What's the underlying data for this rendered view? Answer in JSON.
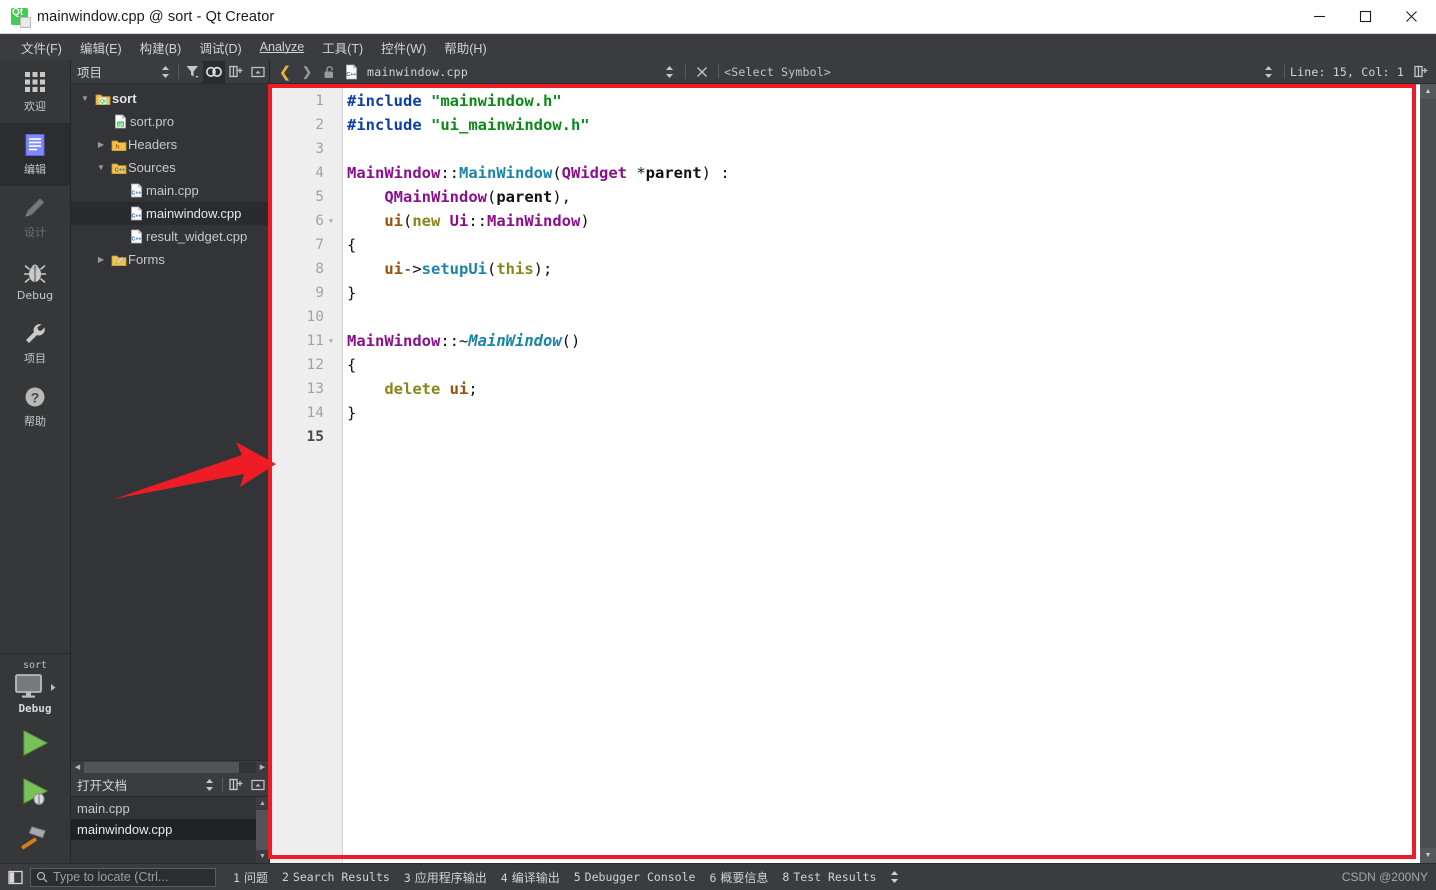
{
  "window": {
    "title": "mainwindow.cpp @ sort - Qt Creator",
    "app_icon": "qt-logo-icon",
    "minimize_label": "—",
    "maximize_label": "□",
    "close_label": "✕"
  },
  "menubar": {
    "items": [
      {
        "text": "文件(F)",
        "mnemonic": "F"
      },
      {
        "text": "编辑(E)",
        "mnemonic": "E"
      },
      {
        "text": "构建(B)",
        "mnemonic": "B"
      },
      {
        "text": "调试(D)",
        "mnemonic": "D"
      },
      {
        "text": "Analyze",
        "mnemonic": "A"
      },
      {
        "text": "工具(T)",
        "mnemonic": "T"
      },
      {
        "text": "控件(W)",
        "mnemonic": "W"
      },
      {
        "text": "帮助(H)",
        "mnemonic": "H"
      }
    ]
  },
  "modebar": {
    "items": [
      {
        "label": "欢迎",
        "icon": "grid-icon",
        "state": "normal"
      },
      {
        "label": "编辑",
        "icon": "document-lines-icon",
        "state": "active"
      },
      {
        "label": "设计",
        "icon": "pencil-icon",
        "state": "disabled"
      },
      {
        "label": "Debug",
        "icon": "bug-icon",
        "state": "normal"
      },
      {
        "label": "项目",
        "icon": "wrench-icon",
        "state": "normal"
      },
      {
        "label": "帮助",
        "icon": "question-mark-icon",
        "state": "normal"
      }
    ],
    "kit_selector": {
      "project": "sort",
      "build_config": "Debug",
      "icon": "monitor-icon",
      "expand_icon": "chevron-right-icon"
    },
    "actions": [
      {
        "name": "run-button",
        "icon": "green-play-icon"
      },
      {
        "name": "debug-button",
        "icon": "green-play-bug-icon"
      },
      {
        "name": "build-button",
        "icon": "hammer-icon"
      }
    ]
  },
  "project_panel": {
    "title": "项目",
    "toolbar": [
      {
        "name": "sync-selector",
        "icon": "up-down-arrows-icon",
        "active": false
      },
      {
        "name": "filter-button",
        "icon": "funnel-icon",
        "active": false
      },
      {
        "name": "link-with-editor",
        "icon": "link-icon",
        "active": true
      },
      {
        "name": "add-split",
        "icon": "split-plus-icon",
        "active": false
      },
      {
        "name": "collapse-panel",
        "icon": "minimize-panel-icon",
        "active": false
      }
    ],
    "tree": [
      {
        "label": "sort",
        "icon": "qt-project-folder-icon",
        "indent": 0,
        "twisty": "down",
        "selected": false,
        "bold": true
      },
      {
        "label": "sort.pro",
        "icon": "qt-pro-file-icon",
        "indent": 1,
        "twisty": "none",
        "selected": false,
        "bold": false
      },
      {
        "label": "Headers",
        "icon": "folder-h-icon",
        "indent": 1,
        "twisty": "right",
        "selected": false,
        "bold": false
      },
      {
        "label": "Sources",
        "icon": "folder-cpp-icon",
        "indent": 1,
        "twisty": "down",
        "selected": false,
        "bold": false
      },
      {
        "label": "main.cpp",
        "icon": "cpp-file-icon",
        "indent": 2,
        "twisty": "none",
        "selected": false,
        "bold": false
      },
      {
        "label": "mainwindow.cpp",
        "icon": "cpp-file-icon",
        "indent": 2,
        "twisty": "none",
        "selected": true,
        "bold": false
      },
      {
        "label": "result_widget.cpp",
        "icon": "cpp-file-icon",
        "indent": 2,
        "twisty": "none",
        "selected": false,
        "bold": false
      },
      {
        "label": "Forms",
        "icon": "folder-forms-icon",
        "indent": 1,
        "twisty": "right",
        "selected": false,
        "bold": false
      }
    ]
  },
  "open_documents": {
    "title": "打开文档",
    "toolbar": [
      {
        "name": "sync-selector",
        "icon": "up-down-arrows-icon"
      },
      {
        "name": "add-split",
        "icon": "split-plus-icon"
      },
      {
        "name": "collapse-panel",
        "icon": "minimize-panel-icon"
      }
    ],
    "items": [
      {
        "label": "main.cpp",
        "selected": false
      },
      {
        "label": "mainwindow.cpp",
        "selected": true
      }
    ]
  },
  "editor_toolbar": {
    "back_icon": "chevron-left-icon",
    "forward_icon": "chevron-right-icon",
    "lock_icon": "unlocked-padlock-icon",
    "file_icon": "cpp-file-icon",
    "filename": "mainwindow.cpp",
    "dropdown_icon": "up-down-arrows-icon",
    "close_icon": "close-x-icon",
    "symbol_selector": "<Select Symbol>",
    "position": "Line: 15, Col: 1",
    "split_icon": "split-plus-icon"
  },
  "editor": {
    "lines": [
      {
        "n": "1",
        "fold": "",
        "tokens": [
          {
            "t": "#include ",
            "c": "t-pre"
          },
          {
            "t": "\"mainwindow.h\"",
            "c": "t-str"
          }
        ]
      },
      {
        "n": "2",
        "fold": "",
        "tokens": [
          {
            "t": "#include ",
            "c": "t-pre"
          },
          {
            "t": "\"ui_mainwindow.h\"",
            "c": "t-str"
          }
        ]
      },
      {
        "n": "3",
        "fold": "",
        "tokens": []
      },
      {
        "n": "4",
        "fold": "",
        "tokens": [
          {
            "t": "MainWindow",
            "c": "t-cls"
          },
          {
            "t": "::",
            "c": "t-pun"
          },
          {
            "t": "MainWindow",
            "c": "t-fn"
          },
          {
            "t": "(",
            "c": "t-pun"
          },
          {
            "t": "QWidget",
            "c": "t-cls"
          },
          {
            "t": " *",
            "c": "t-pun"
          },
          {
            "t": "parent",
            "c": "t-var"
          },
          {
            "t": ") :",
            "c": "t-pun"
          }
        ]
      },
      {
        "n": "5",
        "fold": "",
        "tokens": [
          {
            "t": "    ",
            "c": "t-pun"
          },
          {
            "t": "QMainWindow",
            "c": "t-cls"
          },
          {
            "t": "(",
            "c": "t-pun"
          },
          {
            "t": "parent",
            "c": "t-var"
          },
          {
            "t": "),",
            "c": "t-pun"
          }
        ]
      },
      {
        "n": "6",
        "fold": "fold",
        "tokens": [
          {
            "t": "    ",
            "c": "t-pun"
          },
          {
            "t": "ui",
            "c": "t-mem"
          },
          {
            "t": "(",
            "c": "t-pun"
          },
          {
            "t": "new ",
            "c": "t-kw"
          },
          {
            "t": "Ui",
            "c": "t-cls"
          },
          {
            "t": "::",
            "c": "t-pun"
          },
          {
            "t": "MainWindow",
            "c": "t-cls"
          },
          {
            "t": ")",
            "c": "t-pun"
          }
        ]
      },
      {
        "n": "7",
        "fold": "",
        "tokens": [
          {
            "t": "{",
            "c": "t-pun"
          }
        ]
      },
      {
        "n": "8",
        "fold": "",
        "tokens": [
          {
            "t": "    ",
            "c": "t-pun"
          },
          {
            "t": "ui",
            "c": "t-mem"
          },
          {
            "t": "->",
            "c": "t-pun"
          },
          {
            "t": "setupUi",
            "c": "t-fn"
          },
          {
            "t": "(",
            "c": "t-pun"
          },
          {
            "t": "this",
            "c": "t-kw"
          },
          {
            "t": ");",
            "c": "t-pun"
          }
        ]
      },
      {
        "n": "9",
        "fold": "",
        "tokens": [
          {
            "t": "}",
            "c": "t-pun"
          }
        ]
      },
      {
        "n": "10",
        "fold": "",
        "tokens": []
      },
      {
        "n": "11",
        "fold": "fold",
        "tokens": [
          {
            "t": "MainWindow",
            "c": "t-cls"
          },
          {
            "t": "::~",
            "c": "t-pun"
          },
          {
            "t": "MainWindow",
            "c": "t-fni"
          },
          {
            "t": "()",
            "c": "t-pun"
          }
        ]
      },
      {
        "n": "12",
        "fold": "",
        "tokens": [
          {
            "t": "{",
            "c": "t-pun"
          }
        ]
      },
      {
        "n": "13",
        "fold": "",
        "tokens": [
          {
            "t": "    ",
            "c": "t-pun"
          },
          {
            "t": "delete ",
            "c": "t-kw"
          },
          {
            "t": "ui",
            "c": "t-mem"
          },
          {
            "t": ";",
            "c": "t-pun"
          }
        ]
      },
      {
        "n": "14",
        "fold": "",
        "tokens": [
          {
            "t": "}",
            "c": "t-pun"
          }
        ]
      },
      {
        "n": "15",
        "fold": "",
        "current": true,
        "tokens": []
      }
    ]
  },
  "annotation": {
    "rect_color": "#ee1c25",
    "arrow_color": "#ee1c25",
    "arrow_direction": "right"
  },
  "statusbar": {
    "sidebar_toggle_icon": "sidebar-toggle-icon",
    "search_icon": "search-icon",
    "search_placeholder": "Type to locate (Ctrl...",
    "search_value": "",
    "panes": [
      {
        "num": "1",
        "label": "问题",
        "cjk": true
      },
      {
        "num": "2",
        "label": "Search Results",
        "cjk": false
      },
      {
        "num": "3",
        "label": "应用程序输出",
        "cjk": true
      },
      {
        "num": "4",
        "label": "编译输出",
        "cjk": true
      },
      {
        "num": "5",
        "label": "Debugger Console",
        "cjk": false
      },
      {
        "num": "6",
        "label": "概要信息",
        "cjk": true
      },
      {
        "num": "8",
        "label": "Test Results",
        "cjk": false
      }
    ],
    "pane_selector_icon": "up-down-arrows-icon",
    "watermark": "CSDN @200NY"
  },
  "colors": {
    "accent_red": "#ee1c25",
    "qt_green": "#41cd52",
    "chrome_dark": "#3a3c3f",
    "panel_dark": "#333437",
    "editor_bg": "#ffffff"
  }
}
